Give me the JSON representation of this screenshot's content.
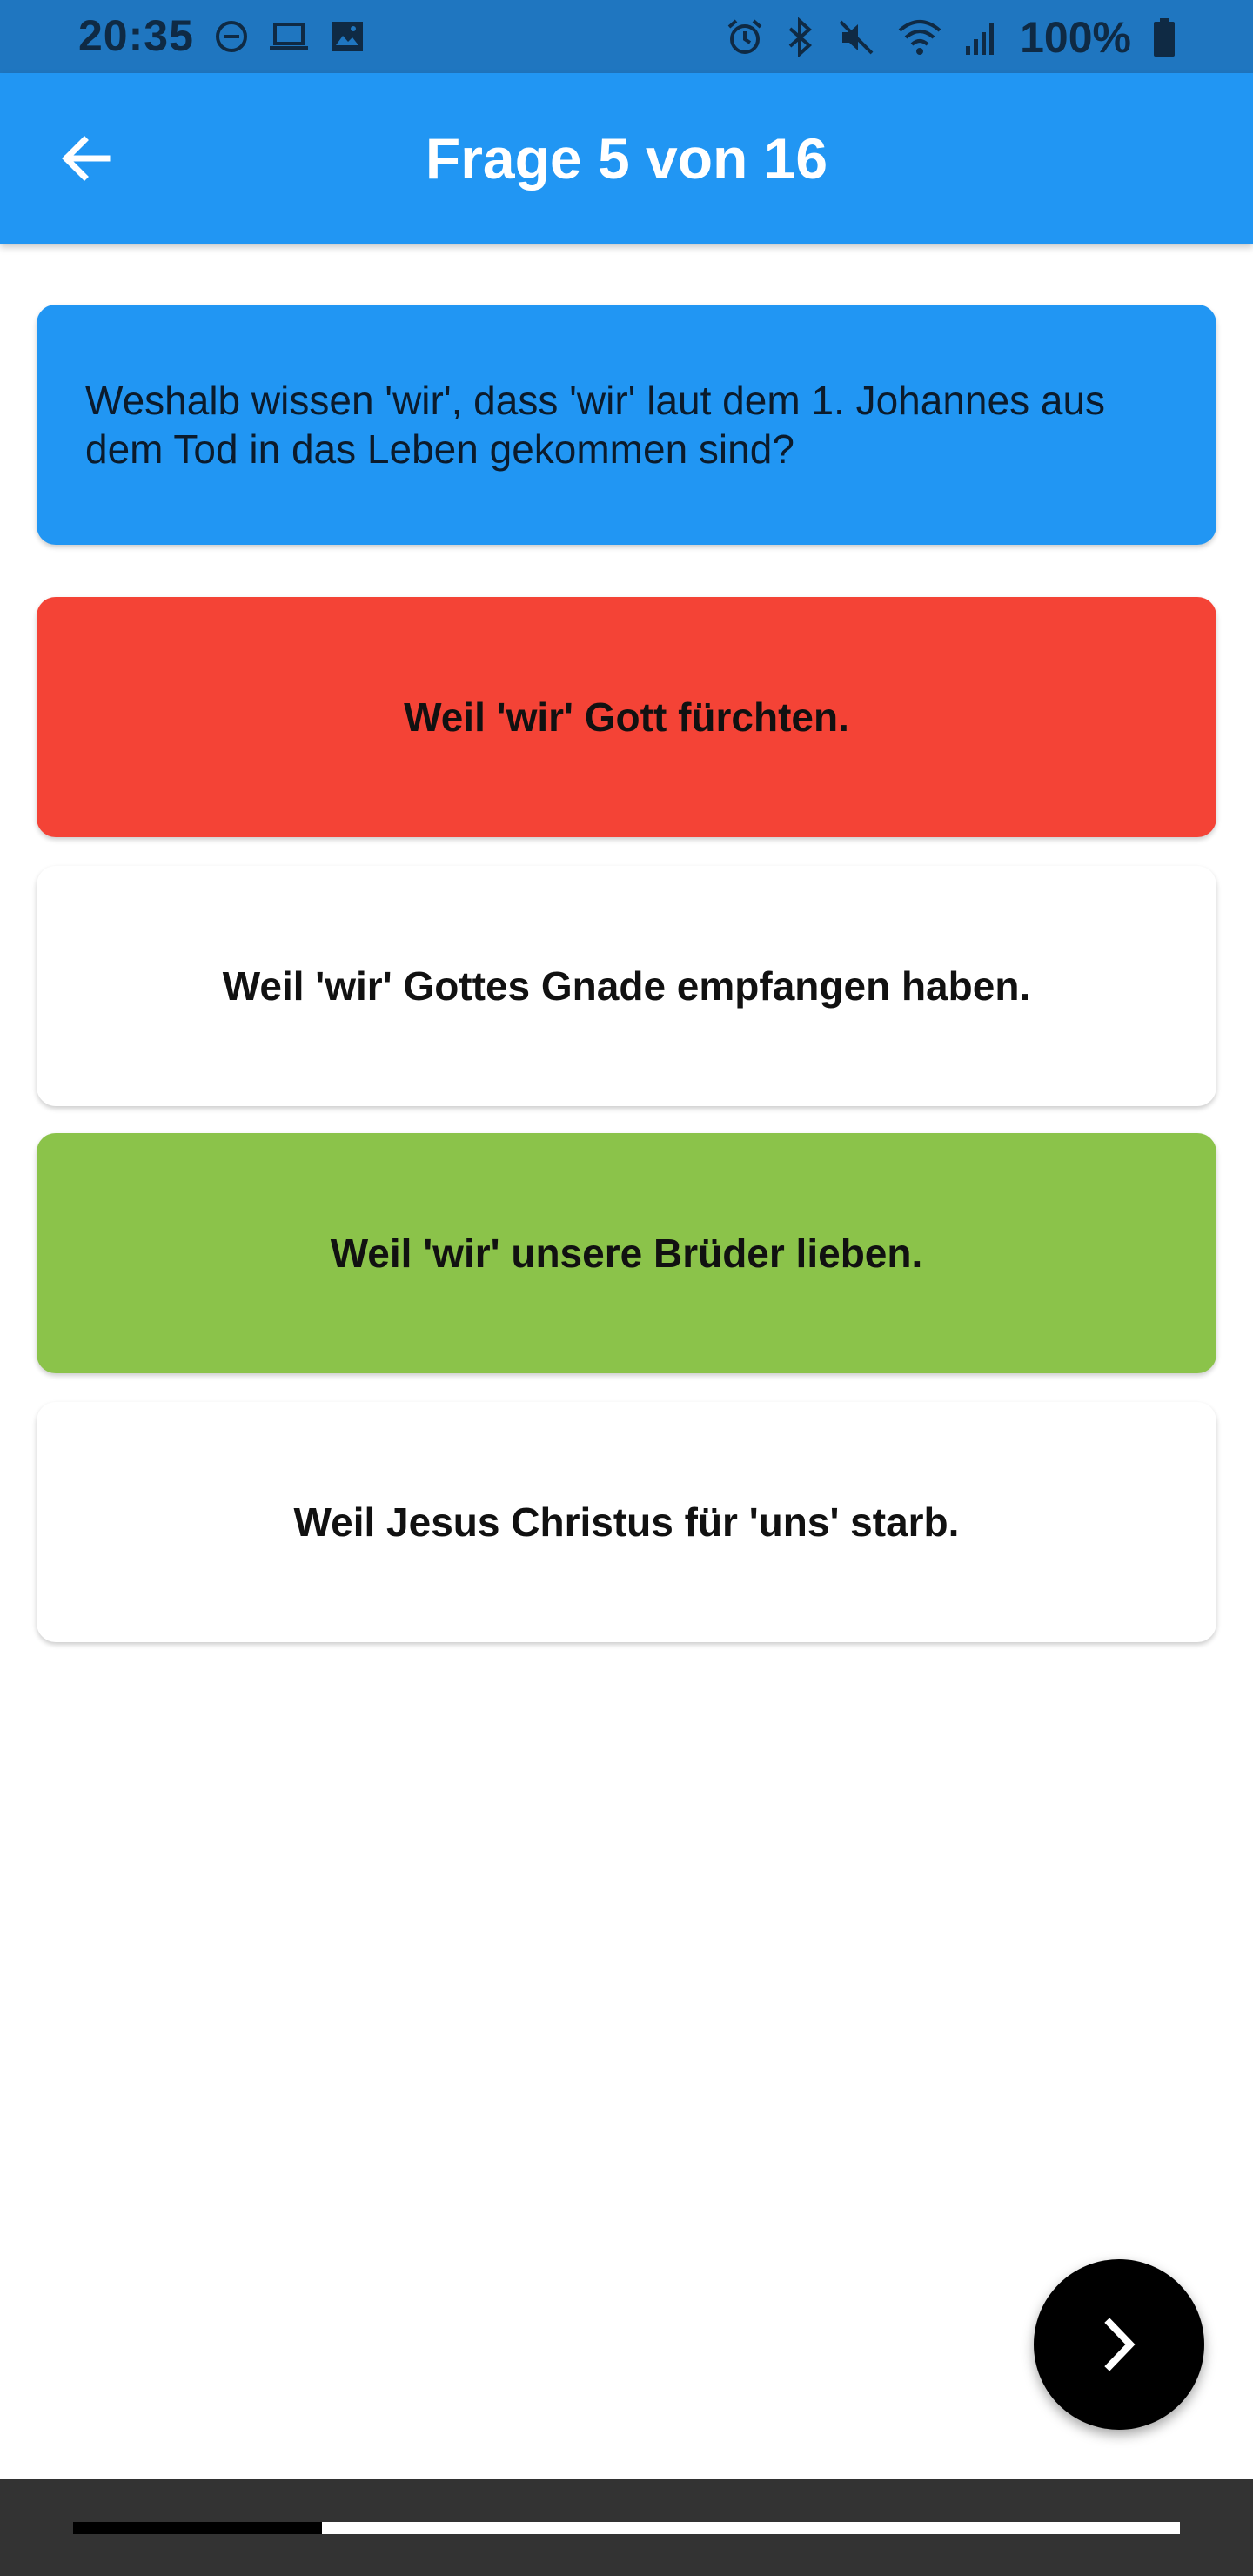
{
  "status_bar": {
    "time": "20:35",
    "battery": "100%",
    "icons_left": [
      "do-not-disturb-icon",
      "laptop-icon",
      "image-icon"
    ],
    "icons_right": [
      "alarm-icon",
      "bluetooth-icon",
      "mute-icon",
      "wifi-icon",
      "signal-icon",
      "battery-icon"
    ]
  },
  "app_bar": {
    "title": "Frage 5 von 16",
    "back_icon": "arrow-left-icon",
    "background": "#2196f3"
  },
  "question": {
    "text": "Weshalb wissen 'wir', dass 'wir' laut dem 1. Johannes aus dem Tod in das Leben gekommen sind?",
    "background": "#2196f3"
  },
  "answers": [
    {
      "text": "Weil 'wir' Gott fürchten.",
      "state": "wrong",
      "color": "#f44336"
    },
    {
      "text": "Weil 'wir' Gottes Gnade empfangen haben.",
      "state": "neutral",
      "color": "#ffffff"
    },
    {
      "text": "Weil 'wir' unsere Brüder lieben.",
      "state": "correct",
      "color": "#8bc34a"
    },
    {
      "text": "Weil Jesus Christus für 'uns' starb.",
      "state": "neutral",
      "color": "#ffffff"
    }
  ],
  "next_button": {
    "icon": "chevron-right-icon"
  },
  "progress": {
    "current": 5,
    "total": 16,
    "fraction": 0.225
  }
}
